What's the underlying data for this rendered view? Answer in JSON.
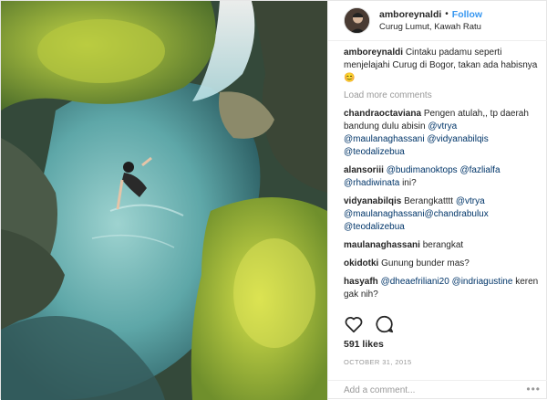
{
  "header": {
    "username": "amboreynaldi",
    "separator": "•",
    "follow_label": "Follow",
    "location": "Curug Lumut, Kawah Ratu"
  },
  "caption": {
    "username": "amboreynaldi",
    "text": "Cintaku padamu seperti menjelajahi Curug di Bogor, takan ada habisnya 😊"
  },
  "load_more_label": "Load more comments",
  "comments": [
    {
      "username": "chandraoctaviana",
      "text": "Pengen atulah,, tp daerah bandung dulu abisin",
      "mentions": [
        "@vtrya",
        "@maulanaghassani",
        "@vidyanabilqis",
        "@teodalizebua"
      ]
    },
    {
      "username": "alansoriii",
      "text": "",
      "mentions": [
        "@budimanoktops",
        "@fazlialfa",
        "@rhadiwinata"
      ],
      "suffix": "ini?"
    },
    {
      "username": "vidyanabilqis",
      "text": "Berangkatttt",
      "mentions": [
        "@vtrya",
        "@maulanaghassani@chandrabulux",
        "@teodalizebua"
      ]
    },
    {
      "username": "maulanaghassani",
      "text": "berangkat",
      "mentions": []
    },
    {
      "username": "okidotki",
      "text": "Gunung bunder mas?",
      "mentions": []
    },
    {
      "username": "hasyafh",
      "text": "",
      "mentions": [
        "@dheaefriliani20",
        "@indriagustine"
      ],
      "suffix": "keren gak nih?"
    }
  ],
  "actions": {
    "like_icon": "heart-outline-icon",
    "comment_icon": "speech-bubble-icon"
  },
  "likes": "591 likes",
  "date": "OCTOBER 31, 2015",
  "add_comment_placeholder": "Add a comment...",
  "more_icon": "•••",
  "colors": {
    "link": "#3897f0",
    "mention": "#003569",
    "muted": "#999999"
  }
}
